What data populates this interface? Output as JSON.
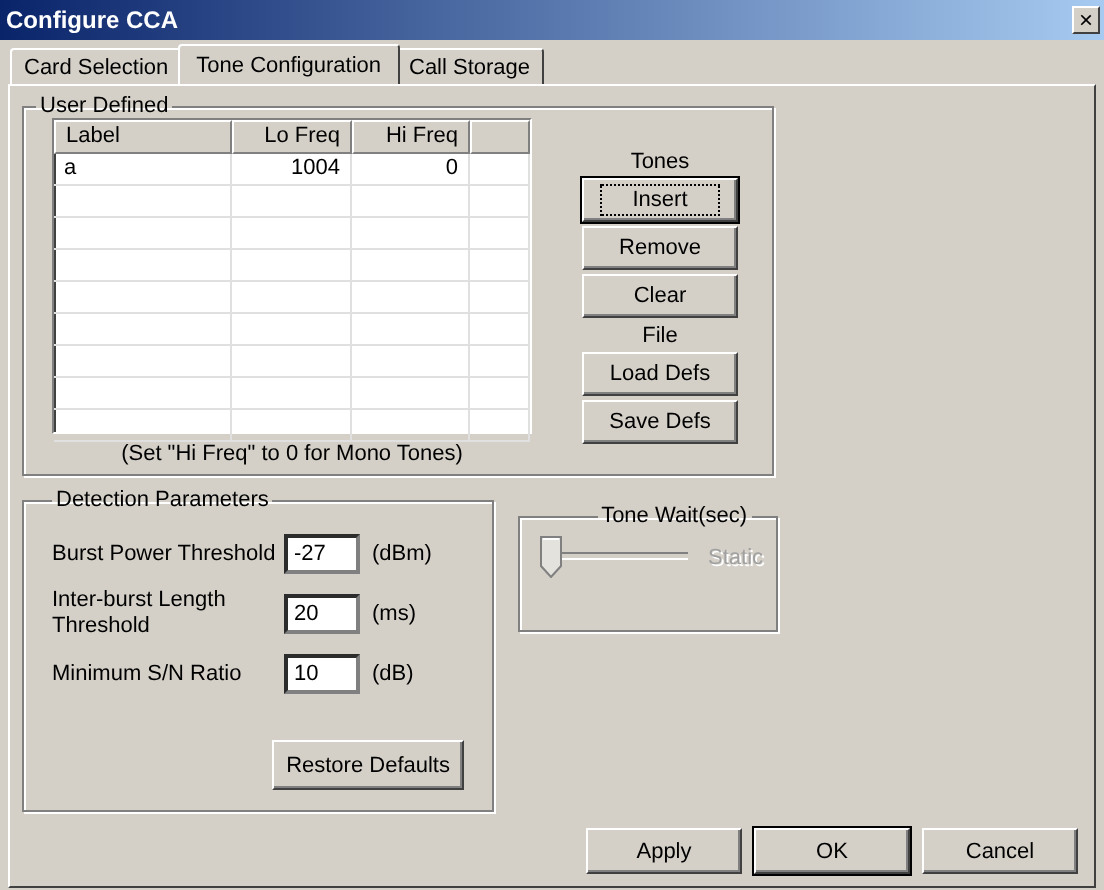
{
  "window": {
    "title": "Configure CCA",
    "close": "×"
  },
  "tabs": [
    {
      "label": "Card Selection",
      "selected": false
    },
    {
      "label": "Tone Configuration",
      "selected": true
    },
    {
      "label": "Call Storage",
      "selected": false
    }
  ],
  "user_defined": {
    "title": "User Defined",
    "table": {
      "columns": [
        "Label",
        "Lo Freq",
        "Hi Freq"
      ],
      "rows": [
        [
          "a",
          "1004",
          "0"
        ]
      ]
    },
    "note": "(Set \"Hi Freq\" to 0 for Mono Tones)",
    "tones_label": "Tones",
    "tones_buttons": [
      {
        "label": "Insert",
        "default": true,
        "focused": true
      },
      {
        "label": "Remove",
        "default": false,
        "focused": false
      },
      {
        "label": "Clear",
        "default": false,
        "focused": false
      }
    ],
    "file_label": "File",
    "file_buttons": [
      {
        "label": "Load Defs",
        "default": false,
        "focused": false
      },
      {
        "label": "Save Defs",
        "default": false,
        "focused": false
      }
    ]
  },
  "detection": {
    "title": "Detection Parameters",
    "params": [
      {
        "label": "Burst Power Threshold",
        "value": "-27",
        "unit": "(dBm)"
      },
      {
        "label": "Inter-burst Length Threshold",
        "value": "20",
        "unit": "(ms)"
      },
      {
        "label": "Minimum S/N Ratio",
        "value": "10",
        "unit": "(dB)"
      }
    ],
    "restore": "Restore Defaults"
  },
  "tone_wait": {
    "title": "Tone Wait(sec)",
    "level": 0,
    "disabled": true,
    "reading": "Static"
  },
  "buttons": [
    {
      "label": "Apply",
      "default": false
    },
    {
      "label": "OK",
      "default": true
    },
    {
      "label": "Cancel",
      "default": false
    }
  ]
}
